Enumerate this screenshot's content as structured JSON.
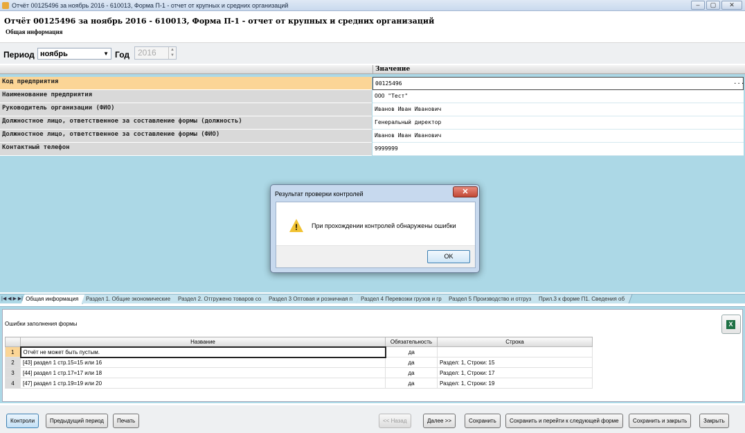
{
  "window": {
    "title": "Отчёт 00125496 за ноябрь 2016 - 610013, Форма П-1 - отчет от крупных и средних организаций",
    "buttons": {
      "minimize": "–",
      "maximize": "▢",
      "close": "✕"
    }
  },
  "header": {
    "title": "Отчёт 00125496 за ноябрь 2016 - 610013, Форма П-1 - отчет от крупных и средних организаций",
    "subtitle": "Общая информация"
  },
  "period": {
    "period_label": "Период",
    "period_value": "ноябрь",
    "year_label": "Год",
    "year_value": "2016"
  },
  "grid": {
    "value_header": "Значение",
    "rows": [
      {
        "name": "Код предприятия",
        "value": "00125496"
      },
      {
        "name": "Наименование предприятия",
        "value": "ООО \"Тест\""
      },
      {
        "name": "Руководитель организации (ФИО)",
        "value": "Иванов Иван Иванович"
      },
      {
        "name": "Должностное лицо, ответственное за составление формы (должность)",
        "value": "Генеральный директор"
      },
      {
        "name": "Должностное лицо, ответственное за составление формы (ФИО)",
        "value": "Иванов Иван Иванович"
      },
      {
        "name": "Контактный телефон",
        "value": "9999999"
      }
    ],
    "ellipsis": "..."
  },
  "dialog": {
    "title": "Результат проверки контролей",
    "message": "При прохождении контролей обнаружены ошибки",
    "ok": "OK",
    "close": "✕"
  },
  "tabs": {
    "nav": "|◀ ◀ ▶ ▶|",
    "items": [
      "Общая информация",
      "Раздел 1. Общие экономические",
      "Раздел 2. Отгружено товаров со",
      "Раздел 3 Оптовая и розничная п",
      "Раздел 4 Перевозки грузов и гр",
      "Раздел 5 Производство и отгруз",
      "Прил.3 к форме П1. Сведения об"
    ]
  },
  "errors": {
    "title": "Ошибки заполнения формы",
    "columns": [
      "Название",
      "Обязательность",
      "Строка"
    ],
    "rows": [
      {
        "n": "1",
        "name": "Отчёт не может быть пустым.",
        "req": "да",
        "line": ""
      },
      {
        "n": "2",
        "name": "[43] раздел 1 стр.15=15 или 16",
        "req": "да",
        "line": "Раздел: 1, Строки: 15"
      },
      {
        "n": "3",
        "name": "[44] раздел 1 стр.17=17 или 18",
        "req": "да",
        "line": "Раздел: 1, Строки: 17"
      },
      {
        "n": "4",
        "name": "[47] раздел 1 стр.19=19 или 20",
        "req": "да",
        "line": "Раздел: 1, Строки: 19"
      }
    ]
  },
  "buttons": {
    "controls": "Контроли",
    "prev_period": "Предыдущий период",
    "print": "Печать",
    "back": "<< Назад",
    "next": "Далее >>",
    "save": "Сохранить",
    "save_next": "Сохранить и перейти к следующей форме",
    "save_close": "Сохранить и закрыть",
    "close": "Закрыть"
  }
}
